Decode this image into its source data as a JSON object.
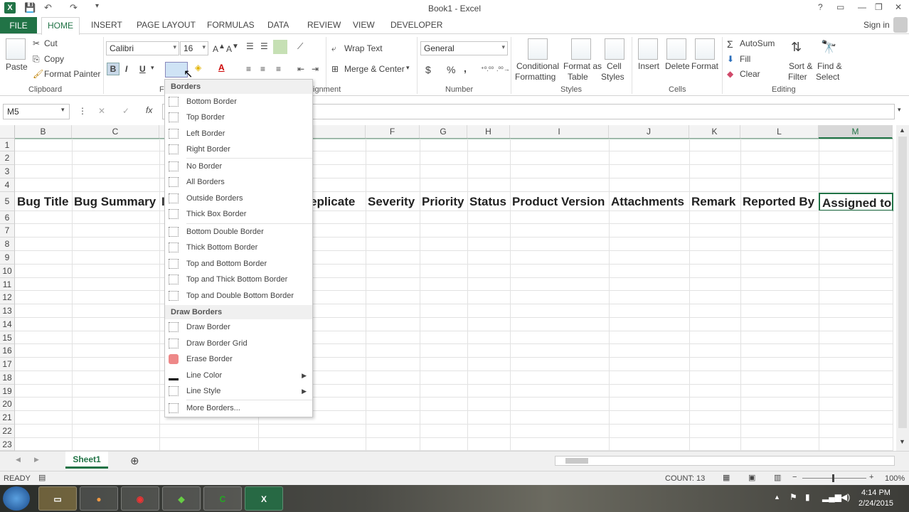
{
  "window": {
    "title": "Book1 - Excel",
    "help": "?"
  },
  "tabs": [
    "FILE",
    "HOME",
    "INSERT",
    "PAGE LAYOUT",
    "FORMULAS",
    "DATA",
    "REVIEW",
    "VIEW",
    "DEVELOPER"
  ],
  "sign_in": "Sign in",
  "ribbon": {
    "clipboard": {
      "paste": "Paste",
      "cut": "Cut",
      "copy": "Copy",
      "format_painter": "Format Painter",
      "label": "Clipboard"
    },
    "font": {
      "name": "Calibri",
      "size": "16",
      "bold": "B",
      "italic": "I",
      "underline": "U",
      "label_fragment": "F"
    },
    "alignment": {
      "wrap": "Wrap Text",
      "merge": "Merge & Center",
      "label_fragment": "ignment"
    },
    "number": {
      "format": "General",
      "currency": "$",
      "percent": "%",
      "comma": ",",
      "label": "Number"
    },
    "styles": {
      "cond1": "Conditional",
      "cond2": "Formatting",
      "fat1": "Format as",
      "fat2": "Table",
      "cs1": "Cell",
      "cs2": "Styles",
      "label": "Styles"
    },
    "cells": {
      "insert": "Insert",
      "delete": "Delete",
      "format": "Format",
      "label": "Cells"
    },
    "editing": {
      "autosum": "AutoSum",
      "fill": "Fill",
      "clear": "Clear",
      "sort1": "Sort &",
      "sort2": "Filter",
      "find1": "Find &",
      "find2": "Select",
      "label": "Editing"
    }
  },
  "formula_bar": {
    "name_box": "M5",
    "fx": "fx",
    "cancel": "✕",
    "enter": "✓"
  },
  "columns": [
    "B",
    "C",
    "F",
    "G",
    "H",
    "I",
    "J",
    "K",
    "L",
    "M"
  ],
  "rows": [
    "1",
    "2",
    "3",
    "4",
    "5",
    "6",
    "7",
    "8",
    "9",
    "10",
    "11",
    "12",
    "13",
    "14",
    "15",
    "16",
    "17",
    "18",
    "19",
    "20",
    "21",
    "22",
    "23"
  ],
  "header_cells": [
    "Bug Title",
    "Bug Summary",
    "eplicate",
    "Severity",
    "Priority",
    "Status",
    "Product Version",
    "Attachments",
    "Remark",
    "Reported By",
    "Assigned to"
  ],
  "borders_menu": {
    "header": "Borders",
    "items": [
      "Bottom Border",
      "Top Border",
      "Left Border",
      "Right Border",
      "No Border",
      "All Borders",
      "Outside Borders",
      "Thick Box Border",
      "Bottom Double Border",
      "Thick Bottom Border",
      "Top and Bottom Border",
      "Top and Thick Bottom Border",
      "Top and Double Bottom Border"
    ],
    "draw_header": "Draw Borders",
    "draw_items": [
      "Draw Border",
      "Draw Border Grid",
      "Erase Border",
      "Line Color",
      "Line Style",
      "More Borders..."
    ]
  },
  "sheet": {
    "tab": "Sheet1",
    "add": "⊕"
  },
  "status": {
    "ready": "READY",
    "count": "COUNT: 13",
    "zoom": "100%"
  },
  "taskbar": {
    "time": "4:14 PM",
    "date": "2/24/2015"
  },
  "colors": {
    "accent": "#217346"
  }
}
